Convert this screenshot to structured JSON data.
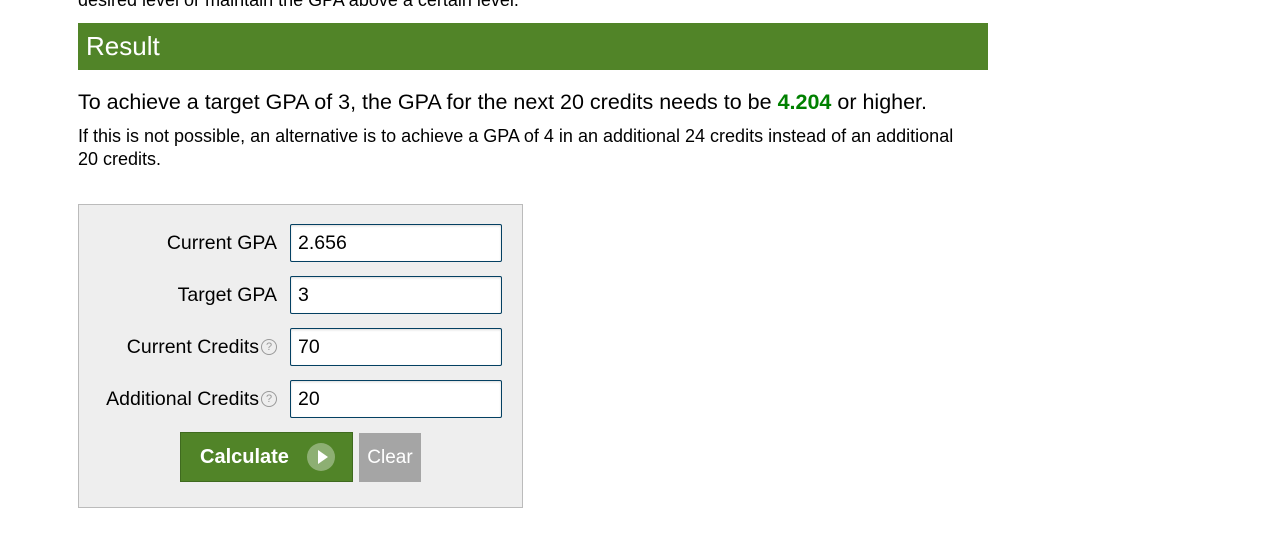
{
  "intro": {
    "tail_text": "desired level or maintain the GPA above a certain level."
  },
  "result": {
    "title": "Result",
    "main_prefix": "To achieve a target GPA of 3, the GPA for the next 20 credits needs to be ",
    "main_value": "4.204",
    "main_suffix": " or higher.",
    "alternative": "If this is not possible, an alternative is to achieve a GPA of 4 in an additional 24 credits instead of an additional 20 credits."
  },
  "form": {
    "current_gpa": {
      "label": "Current GPA",
      "value": "2.656"
    },
    "target_gpa": {
      "label": "Target GPA",
      "value": "3"
    },
    "current_credits": {
      "label": "Current Credits",
      "value": "70",
      "help_icon": "question-circle-icon"
    },
    "additional_credits": {
      "label": "Additional Credits",
      "value": "20",
      "help_icon": "question-circle-icon"
    },
    "help_glyph": "?",
    "calculate_label": "Calculate",
    "clear_label": "Clear"
  },
  "colors": {
    "accent_green": "#518428",
    "result_value_green": "#008000",
    "clear_gray": "#a5a5a5"
  }
}
